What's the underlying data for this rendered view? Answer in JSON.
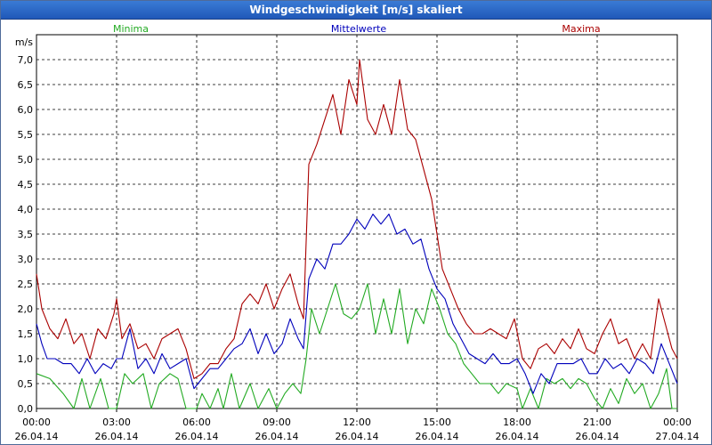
{
  "window": {
    "title": "Windgeschwindigkeit [m/s] skaliert"
  },
  "colors": {
    "minima": "#22aa22",
    "mittel": "#0000bb",
    "maxima": "#aa0000",
    "titlebar": "#2a66c4"
  },
  "chart_data": {
    "type": "line",
    "title": "Windgeschwindigkeit [m/s] skaliert",
    "ylabel": "m/s",
    "ylim": [
      0,
      7.5
    ],
    "yticks": [
      "0,0",
      "0,5",
      "1,0",
      "1,5",
      "2,0",
      "2,5",
      "3,0",
      "3,5",
      "4,0",
      "4,5",
      "5,0",
      "5,5",
      "6,0",
      "6,5",
      "7,0"
    ],
    "xlim_hours": [
      0,
      24
    ],
    "xticks": [
      {
        "time": "00:00",
        "date": "26.04.14"
      },
      {
        "time": "03:00",
        "date": "26.04.14"
      },
      {
        "time": "06:00",
        "date": "26.04.14"
      },
      {
        "time": "09:00",
        "date": "26.04.14"
      },
      {
        "time": "12:00",
        "date": "26.04.14"
      },
      {
        "time": "15:00",
        "date": "26.04.14"
      },
      {
        "time": "18:00",
        "date": "26.04.14"
      },
      {
        "time": "21:00",
        "date": "26.04.14"
      },
      {
        "time": "00:00",
        "date": "27.04.14"
      }
    ],
    "grid": true,
    "legend": "top",
    "series": [
      {
        "name": "Minima",
        "points": [
          [
            0,
            0.7
          ],
          [
            0.5,
            0.6
          ],
          [
            1,
            0.3
          ],
          [
            1.4,
            0
          ],
          [
            1.7,
            0.6
          ],
          [
            2,
            0
          ],
          [
            2.4,
            0.6
          ],
          [
            2.7,
            0
          ],
          [
            3,
            0
          ],
          [
            3.3,
            0.7
          ],
          [
            3.6,
            0.5
          ],
          [
            4,
            0.7
          ],
          [
            4.3,
            0
          ],
          [
            4.6,
            0.5
          ],
          [
            5,
            0.7
          ],
          [
            5.3,
            0.6
          ],
          [
            5.6,
            0
          ],
          [
            6,
            0
          ],
          [
            6.2,
            0.3
          ],
          [
            6.5,
            0
          ],
          [
            6.8,
            0.4
          ],
          [
            7,
            0
          ],
          [
            7.3,
            0.7
          ],
          [
            7.6,
            0
          ],
          [
            8,
            0.5
          ],
          [
            8.3,
            0
          ],
          [
            8.7,
            0.4
          ],
          [
            9,
            0
          ],
          [
            9.3,
            0.3
          ],
          [
            9.6,
            0.5
          ],
          [
            9.9,
            0.3
          ],
          [
            10.1,
            1.0
          ],
          [
            10.3,
            2.0
          ],
          [
            10.6,
            1.5
          ],
          [
            10.9,
            2.0
          ],
          [
            11.2,
            2.5
          ],
          [
            11.5,
            1.9
          ],
          [
            11.8,
            1.8
          ],
          [
            12.1,
            2.0
          ],
          [
            12.4,
            2.5
          ],
          [
            12.7,
            1.5
          ],
          [
            13,
            2.2
          ],
          [
            13.3,
            1.5
          ],
          [
            13.6,
            2.4
          ],
          [
            13.9,
            1.3
          ],
          [
            14.2,
            2.0
          ],
          [
            14.5,
            1.7
          ],
          [
            14.8,
            2.4
          ],
          [
            15.1,
            2.0
          ],
          [
            15.4,
            1.5
          ],
          [
            15.7,
            1.3
          ],
          [
            16,
            0.9
          ],
          [
            16.3,
            0.7
          ],
          [
            16.6,
            0.5
          ],
          [
            17,
            0.5
          ],
          [
            17.3,
            0.3
          ],
          [
            17.6,
            0.5
          ],
          [
            18,
            0.4
          ],
          [
            18.2,
            0
          ],
          [
            18.5,
            0.4
          ],
          [
            18.8,
            0
          ],
          [
            19.1,
            0.6
          ],
          [
            19.4,
            0.5
          ],
          [
            19.7,
            0.6
          ],
          [
            20,
            0.4
          ],
          [
            20.3,
            0.6
          ],
          [
            20.6,
            0.5
          ],
          [
            20.9,
            0.2
          ],
          [
            21.2,
            0
          ],
          [
            21.5,
            0.4
          ],
          [
            21.8,
            0.1
          ],
          [
            22.1,
            0.6
          ],
          [
            22.4,
            0.3
          ],
          [
            22.7,
            0.5
          ],
          [
            23,
            0
          ],
          [
            23.3,
            0.3
          ],
          [
            23.6,
            0.8
          ],
          [
            23.8,
            0
          ],
          [
            24,
            0
          ]
        ]
      },
      {
        "name": "Mittelwerte",
        "points": [
          [
            0,
            1.7
          ],
          [
            0.2,
            1.3
          ],
          [
            0.4,
            1.0
          ],
          [
            0.7,
            1.0
          ],
          [
            1,
            0.9
          ],
          [
            1.3,
            0.9
          ],
          [
            1.6,
            0.7
          ],
          [
            1.9,
            1.0
          ],
          [
            2.2,
            0.7
          ],
          [
            2.5,
            0.9
          ],
          [
            2.8,
            0.8
          ],
          [
            3,
            1.0
          ],
          [
            3.2,
            1.0
          ],
          [
            3.5,
            1.6
          ],
          [
            3.8,
            0.8
          ],
          [
            4.1,
            1.0
          ],
          [
            4.4,
            0.7
          ],
          [
            4.7,
            1.1
          ],
          [
            5,
            0.8
          ],
          [
            5.3,
            0.9
          ],
          [
            5.6,
            1.0
          ],
          [
            5.9,
            0.4
          ],
          [
            6.2,
            0.6
          ],
          [
            6.5,
            0.8
          ],
          [
            6.8,
            0.8
          ],
          [
            7.1,
            1.0
          ],
          [
            7.4,
            1.2
          ],
          [
            7.7,
            1.3
          ],
          [
            8,
            1.6
          ],
          [
            8.3,
            1.1
          ],
          [
            8.6,
            1.5
          ],
          [
            8.9,
            1.1
          ],
          [
            9.2,
            1.3
          ],
          [
            9.5,
            1.8
          ],
          [
            9.8,
            1.4
          ],
          [
            10,
            1.2
          ],
          [
            10.2,
            2.6
          ],
          [
            10.5,
            3.0
          ],
          [
            10.8,
            2.8
          ],
          [
            11.1,
            3.3
          ],
          [
            11.4,
            3.3
          ],
          [
            11.7,
            3.5
          ],
          [
            12,
            3.8
          ],
          [
            12.3,
            3.6
          ],
          [
            12.6,
            3.9
          ],
          [
            12.9,
            3.7
          ],
          [
            13.2,
            3.9
          ],
          [
            13.5,
            3.5
          ],
          [
            13.8,
            3.6
          ],
          [
            14.1,
            3.3
          ],
          [
            14.4,
            3.4
          ],
          [
            14.7,
            2.8
          ],
          [
            15,
            2.4
          ],
          [
            15.3,
            2.2
          ],
          [
            15.6,
            1.7
          ],
          [
            15.9,
            1.4
          ],
          [
            16.2,
            1.1
          ],
          [
            16.5,
            1.0
          ],
          [
            16.8,
            0.9
          ],
          [
            17.1,
            1.1
          ],
          [
            17.4,
            0.9
          ],
          [
            17.7,
            0.9
          ],
          [
            18,
            1.0
          ],
          [
            18.3,
            0.7
          ],
          [
            18.6,
            0.3
          ],
          [
            18.9,
            0.7
          ],
          [
            19.2,
            0.5
          ],
          [
            19.5,
            0.9
          ],
          [
            19.8,
            0.9
          ],
          [
            20.1,
            0.9
          ],
          [
            20.4,
            1.0
          ],
          [
            20.7,
            0.7
          ],
          [
            21,
            0.7
          ],
          [
            21.3,
            1.0
          ],
          [
            21.6,
            0.8
          ],
          [
            21.9,
            0.9
          ],
          [
            22.2,
            0.7
          ],
          [
            22.5,
            1.0
          ],
          [
            22.8,
            0.9
          ],
          [
            23.1,
            0.7
          ],
          [
            23.4,
            1.3
          ],
          [
            23.7,
            0.9
          ],
          [
            24,
            0.5
          ]
        ]
      },
      {
        "name": "Maxima",
        "points": [
          [
            0,
            2.7
          ],
          [
            0.2,
            2.0
          ],
          [
            0.5,
            1.6
          ],
          [
            0.8,
            1.4
          ],
          [
            1.1,
            1.8
          ],
          [
            1.4,
            1.3
          ],
          [
            1.7,
            1.5
          ],
          [
            2,
            1.0
          ],
          [
            2.3,
            1.6
          ],
          [
            2.6,
            1.4
          ],
          [
            2.9,
            1.9
          ],
          [
            3,
            2.2
          ],
          [
            3.2,
            1.4
          ],
          [
            3.5,
            1.7
          ],
          [
            3.8,
            1.2
          ],
          [
            4.1,
            1.3
          ],
          [
            4.4,
            1.0
          ],
          [
            4.7,
            1.4
          ],
          [
            5,
            1.5
          ],
          [
            5.3,
            1.6
          ],
          [
            5.6,
            1.2
          ],
          [
            5.9,
            0.6
          ],
          [
            6.2,
            0.7
          ],
          [
            6.5,
            0.9
          ],
          [
            6.8,
            0.9
          ],
          [
            7.1,
            1.2
          ],
          [
            7.4,
            1.4
          ],
          [
            7.7,
            2.1
          ],
          [
            8,
            2.3
          ],
          [
            8.3,
            2.1
          ],
          [
            8.6,
            2.5
          ],
          [
            8.9,
            2.0
          ],
          [
            9.2,
            2.4
          ],
          [
            9.5,
            2.7
          ],
          [
            9.8,
            2.1
          ],
          [
            10,
            1.8
          ],
          [
            10.2,
            4.9
          ],
          [
            10.5,
            5.3
          ],
          [
            10.8,
            5.8
          ],
          [
            11.1,
            6.3
          ],
          [
            11.4,
            5.5
          ],
          [
            11.7,
            6.6
          ],
          [
            12,
            6.1
          ],
          [
            12.1,
            7.0
          ],
          [
            12.4,
            5.8
          ],
          [
            12.7,
            5.5
          ],
          [
            13,
            6.1
          ],
          [
            13.3,
            5.5
          ],
          [
            13.6,
            6.6
          ],
          [
            13.9,
            5.6
          ],
          [
            14.2,
            5.4
          ],
          [
            14.5,
            4.8
          ],
          [
            14.8,
            4.2
          ],
          [
            15,
            3.5
          ],
          [
            15.2,
            2.8
          ],
          [
            15.5,
            2.4
          ],
          [
            15.8,
            2.0
          ],
          [
            16.1,
            1.7
          ],
          [
            16.4,
            1.5
          ],
          [
            16.7,
            1.5
          ],
          [
            17,
            1.6
          ],
          [
            17.3,
            1.5
          ],
          [
            17.6,
            1.4
          ],
          [
            17.9,
            1.8
          ],
          [
            18.2,
            1.0
          ],
          [
            18.5,
            0.8
          ],
          [
            18.8,
            1.2
          ],
          [
            19.1,
            1.3
          ],
          [
            19.4,
            1.1
          ],
          [
            19.7,
            1.4
          ],
          [
            20,
            1.2
          ],
          [
            20.3,
            1.6
          ],
          [
            20.6,
            1.2
          ],
          [
            20.9,
            1.1
          ],
          [
            21.2,
            1.5
          ],
          [
            21.5,
            1.8
          ],
          [
            21.8,
            1.3
          ],
          [
            22.1,
            1.4
          ],
          [
            22.4,
            1.0
          ],
          [
            22.7,
            1.3
          ],
          [
            23,
            1.0
          ],
          [
            23.3,
            2.2
          ],
          [
            23.6,
            1.6
          ],
          [
            23.8,
            1.2
          ],
          [
            24,
            1.0
          ]
        ]
      }
    ]
  }
}
